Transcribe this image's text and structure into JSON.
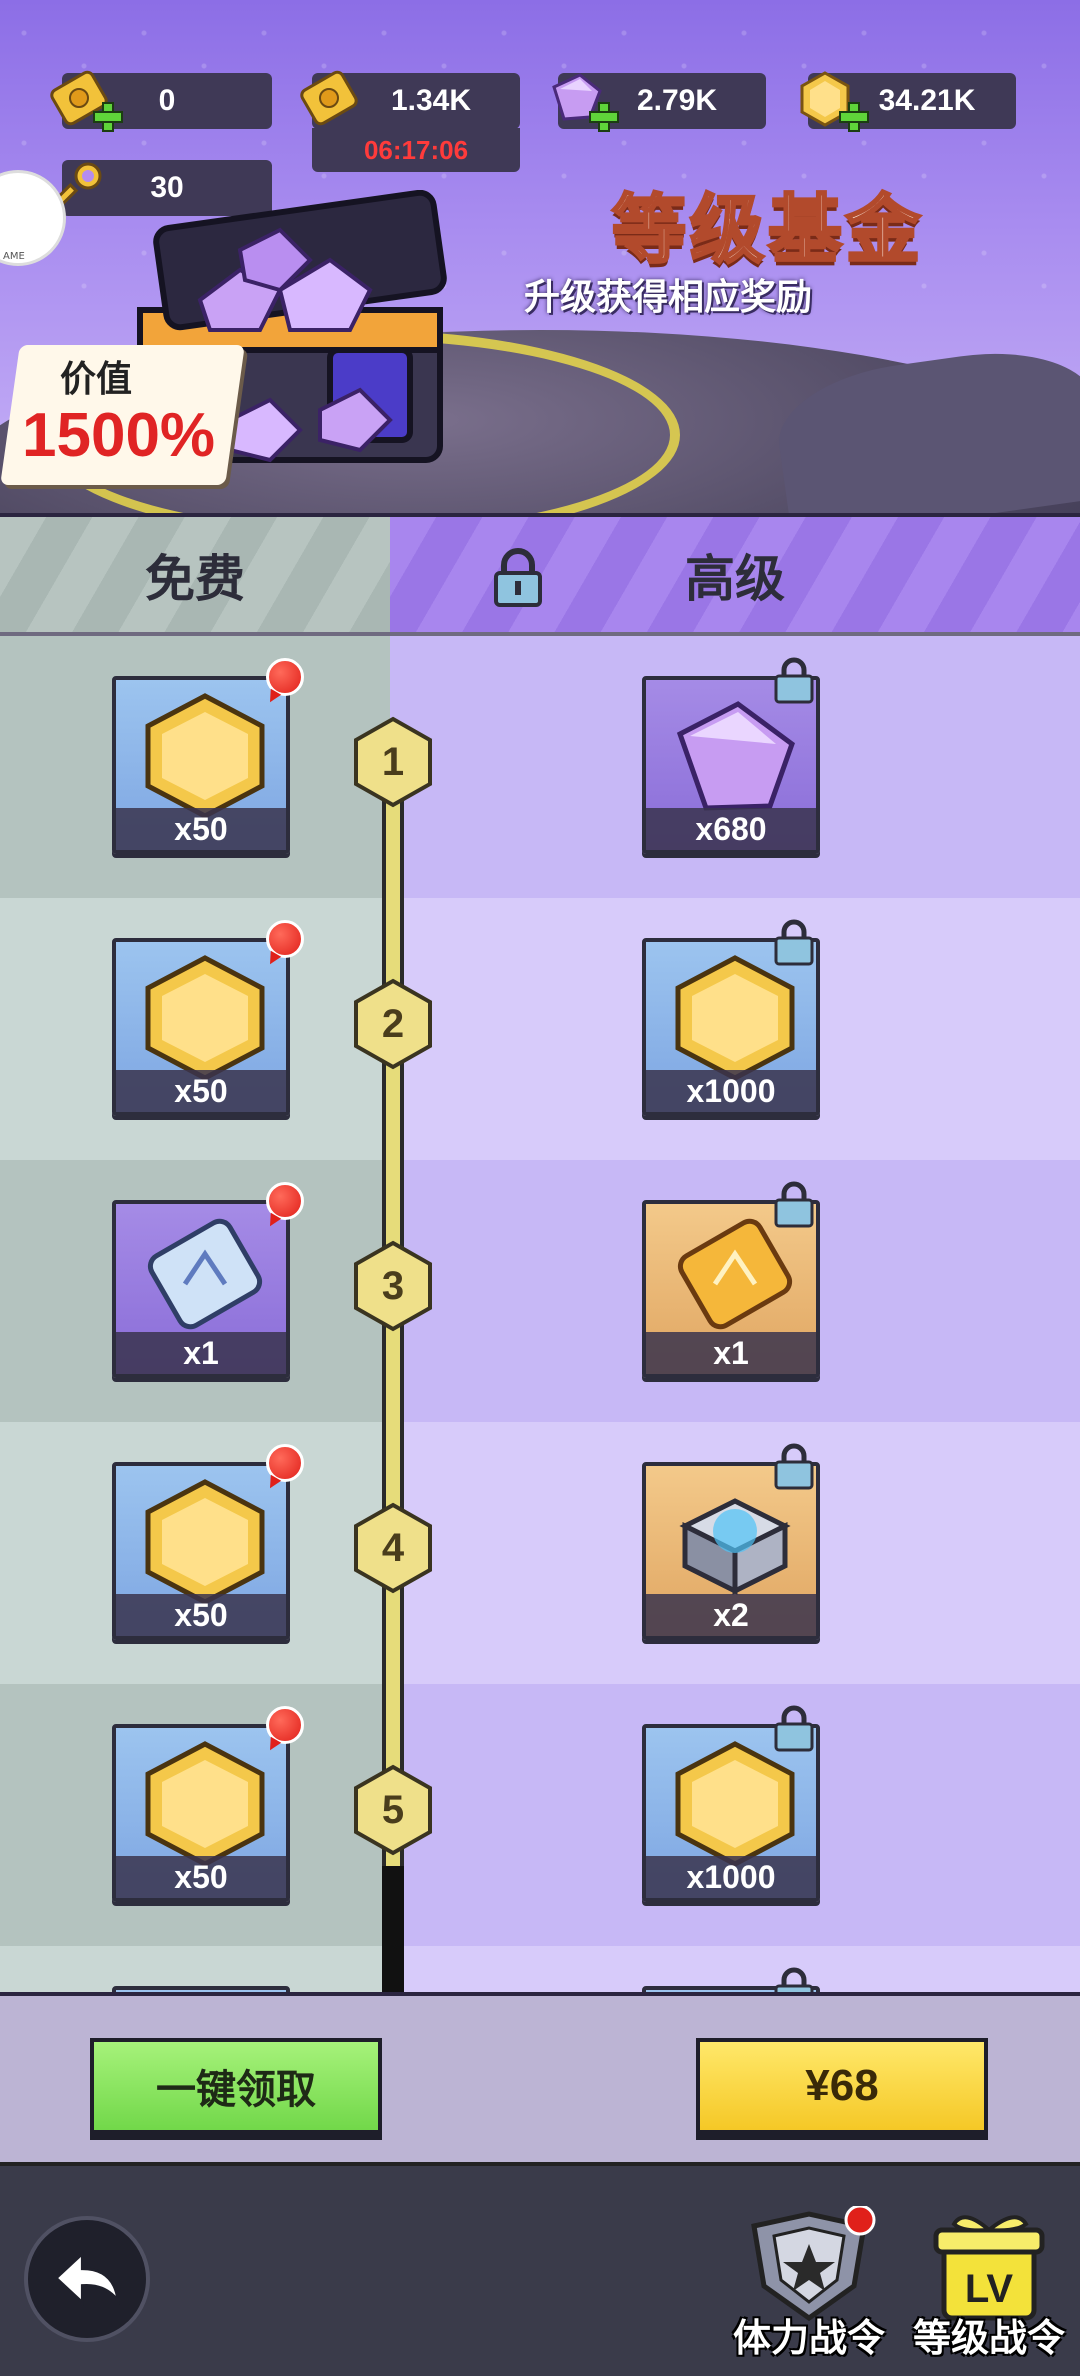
{
  "resources": {
    "ticket_a": "0",
    "ticket_b": "1.34K",
    "timer": "06:17:06",
    "gems": "2.79K",
    "coins": "34.21K",
    "keys": "30"
  },
  "header": {
    "title": "等级基金",
    "subtitle": "升级获得相应奖励",
    "value_label": "价值",
    "value_percent": "1500%"
  },
  "tabs": {
    "free": "免费",
    "premium": "高级"
  },
  "rows": [
    {
      "level": "1",
      "free": {
        "item": "coin-icon",
        "qty": "x50"
      },
      "premium": {
        "item": "gem-icon",
        "qty": "x680"
      }
    },
    {
      "level": "2",
      "free": {
        "item": "coin-icon",
        "qty": "x50"
      },
      "premium": {
        "item": "coin-icon",
        "qty": "x1000"
      }
    },
    {
      "level": "3",
      "free": {
        "item": "blue-ticket-icon",
        "qty": "x1"
      },
      "premium": {
        "item": "gold-ticket-icon",
        "qty": "x1"
      }
    },
    {
      "level": "4",
      "free": {
        "item": "coin-icon",
        "qty": "x50"
      },
      "premium": {
        "item": "metal-block-icon",
        "qty": "x2"
      }
    },
    {
      "level": "5",
      "free": {
        "item": "coin-icon",
        "qty": "x50"
      },
      "premium": {
        "item": "coin-icon",
        "qty": "x1000"
      }
    }
  ],
  "actions": {
    "claim_all": "一键领取",
    "buy": "¥68"
  },
  "nav": {
    "stamina_pass": "体力战令",
    "level_pass": "等级战令"
  },
  "colors": {
    "free_column": "#b4c3bf",
    "premium_column": "#c7b8f6",
    "claim_button": "#72d84a",
    "buy_button": "#f5c826",
    "badge": "#e0201a"
  }
}
